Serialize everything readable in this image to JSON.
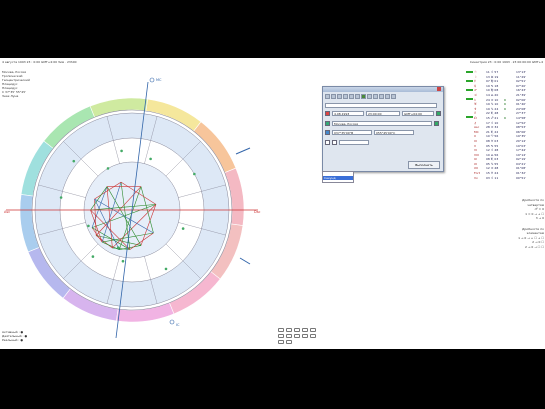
{
  "header": {
    "left": "4 августа 1993  23 : 0:00 GMT+4:00 Зим  ·  23h00",
    "right": "Синастрия  23 : 0:00 1993 · 23 00:00:00 GMT+4"
  },
  "left_info": {
    "city": "Москва, Россия",
    "lines": [
      "Тропический",
      "Геоцентрический",
      "Плацидус",
      "Плацидус",
      "С    37°35'  55°45'",
      "Знак Луна"
    ]
  },
  "left_bottom": {
    "lines": [
      "Активный : ●",
      "Деятельный : ●",
      "Реальный : ●"
    ]
  },
  "wheel": {
    "angle_labels": [
      "Asc",
      "Dsc",
      "MC",
      "IC"
    ],
    "zodiac_colors": [
      "#f4b9c3",
      "#f7c59b",
      "#f5e79c",
      "#cfeaa0",
      "#a9e6b1",
      "#9fe0de",
      "#a9cdee",
      "#b6b8ee",
      "#d7b4ee",
      "#f1b3e3",
      "#f6b7d0",
      "#f3c0c0"
    ]
  },
  "dialog": {
    "title": "",
    "date": "4.08.1993",
    "time": "23:00:00",
    "tz": "GMT+04:00",
    "place": "Москва, Россия",
    "lon": "037°35'00\"В",
    "lat": "055°45'00\"С",
    "ok_label": "Выполнить",
    "dropdown": [
      "",
      "Секунд"
    ]
  },
  "table": {
    "rows": [
      [
        "☉",
        "11 ♌ 57",
        "",
        "13°13'"
      ],
      [
        "☽",
        "13 ♊ 19",
        "",
        "11°29'"
      ],
      [
        "☿",
        "07 ♍ 01",
        "",
        "02°51'"
      ],
      [
        "♀",
        "19 ♋ 18",
        "",
        "07°20'"
      ],
      [
        "♂",
        "10 ♍ 08",
        "",
        "16°43'"
      ],
      [
        "♃",
        "14 ♎ 20",
        "",
        "21°39'"
      ],
      [
        "♄",
        "24 ♒ 10",
        "R",
        "02°06'"
      ],
      [
        "♅",
        "19 ♑ 10",
        "R",
        "01°40'"
      ],
      [
        "♆",
        "19 ♑ 24",
        "R",
        "24°08'"
      ],
      [
        "♇",
        "22 ♏ 48",
        "",
        "27°37'"
      ],
      [
        "☊",
        "15 ♐ 21",
        "R",
        "14°58'"
      ],
      [
        "⚷",
        "17 ♌ 10",
        "",
        "12°52'"
      ],
      [
        "Asc",
        "28 ♒ 32",
        "",
        "08°53'"
      ],
      [
        "MC",
        "21 ♏ 22",
        "",
        "06°06'"
      ],
      [
        "II",
        "10 ♈ 56",
        "",
        "19°35'"
      ],
      [
        "III",
        "08 ♉ 03",
        "",
        "20°14'"
      ],
      [
        "V",
        "05 ♋ 55",
        "",
        "19°03'"
      ],
      [
        "VI",
        "12 ♌ 48",
        "",
        "17°44'"
      ],
      [
        "VIII",
        "10 ♎ 56",
        "",
        "19°14'"
      ],
      [
        "IX",
        "08 ♏ 03",
        "",
        "02°19'"
      ],
      [
        "XI",
        "05 ♑ 55",
        "",
        "04°21'"
      ],
      [
        "XII",
        "12 ♒ 48",
        "",
        "01°08'"
      ],
      [
        "Fort",
        "15 ♓ 24",
        "",
        "01°32'"
      ],
      [
        "Vx",
        "03 ♌ 11",
        "",
        "00°51'"
      ]
    ]
  },
  "formulas": {
    "title1": "Дробности по четвертям",
    "lines1": [
      "d² = 0",
      "1 = 0 → + ☐",
      "3 → 0"
    ],
    "title2": "Дробности по элементам",
    "lines2": [
      "1 → 0 → + ☐ + ☐",
      "2 → 0 ☐",
      "2 → 0 → ☐ ☐"
    ]
  }
}
